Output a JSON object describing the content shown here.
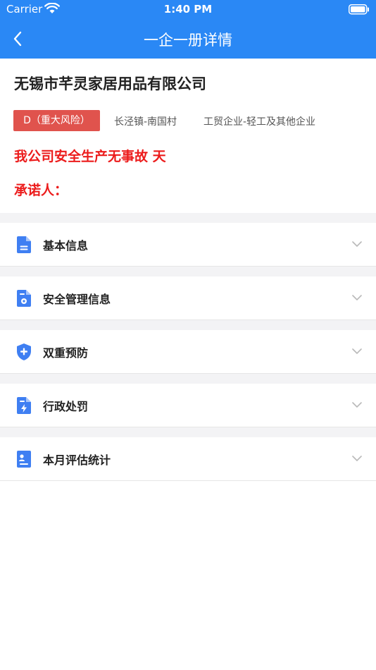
{
  "status_bar": {
    "carrier": "Carrier",
    "time": "1:40 PM"
  },
  "nav": {
    "title": "一企一册详情"
  },
  "company": {
    "name": "无锡市芊灵家居用品有限公司",
    "risk_level": "D（重大风险）",
    "location": "长泾镇-南国村",
    "category": "工贸企业-轻工及其他企业",
    "safety_statement": "我公司安全生产无事故 天",
    "promisor_label": "承诺人："
  },
  "sections": [
    {
      "label": "基本信息",
      "icon": "document-icon"
    },
    {
      "label": "安全管理信息",
      "icon": "gear-document-icon"
    },
    {
      "label": "双重预防",
      "icon": "shield-plus-icon"
    },
    {
      "label": "行政处罚",
      "icon": "lightning-document-icon"
    },
    {
      "label": "本月评估统计",
      "icon": "person-document-icon"
    }
  ],
  "colors": {
    "primary": "#2a88f5",
    "risk_badge": "#e0534d",
    "alert_text": "#ec1c1c",
    "separator": "#f3f3f5"
  }
}
